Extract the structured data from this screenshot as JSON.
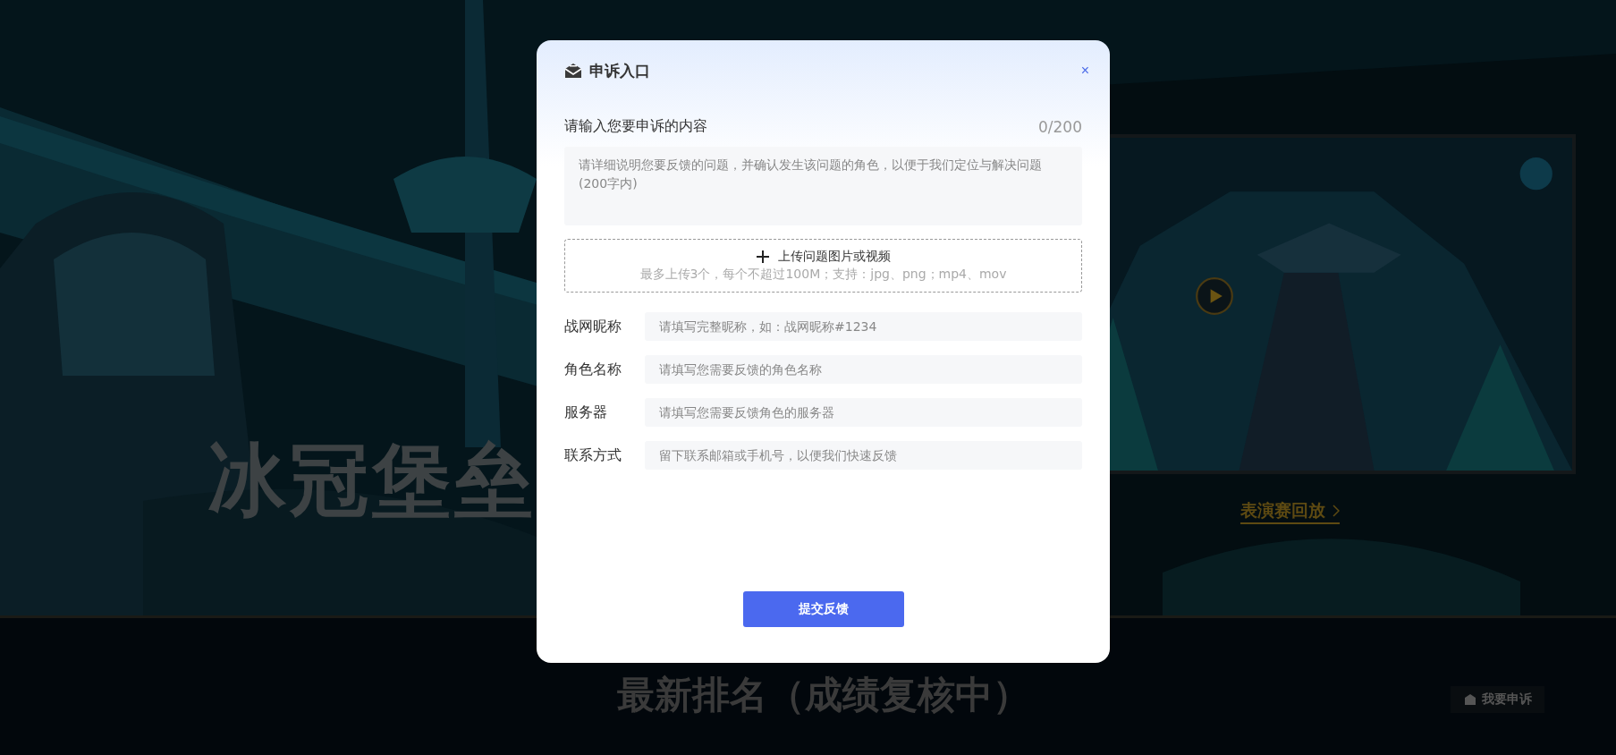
{
  "background": {
    "hero_title": "冰冠堡垒",
    "replay_link": "表演赛回放",
    "ranking_title": "最新排名（成绩复核中）",
    "appeal_button": "我要申诉"
  },
  "dialog": {
    "title": "申诉入口",
    "close": "×",
    "content": {
      "label": "请输入您要申诉的内容",
      "counter": "0/200",
      "placeholder": "请详细说明您要反馈的问题，并确认发生该问题的角色，以便于我们定位与解决问题(200字内)"
    },
    "upload": {
      "title": "上传问题图片或视频",
      "hint": "最多上传3个，每个不超过100M；支持：jpg、png；mp4、mov"
    },
    "fields": [
      {
        "label": "战网昵称",
        "placeholder": "请填写完整昵称，如：战网昵称#1234"
      },
      {
        "label": "角色名称",
        "placeholder": "请填写您需要反馈的角色名称"
      },
      {
        "label": "服务器",
        "placeholder": "请填写您需要反馈角色的服务器"
      },
      {
        "label": "联系方式",
        "placeholder": "留下联系邮箱或手机号，以便我们快速反馈"
      }
    ],
    "submit": "提交反馈"
  }
}
